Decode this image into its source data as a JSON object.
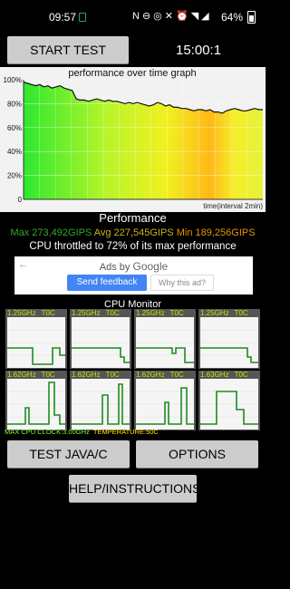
{
  "status_bar": {
    "time": "09:57",
    "battery_text": "64%",
    "icons": [
      "nfc-icon",
      "dnd-icon",
      "hotspot-icon",
      "mute-icon",
      "alarm-off-icon",
      "wifi-icon",
      "signal-icon",
      "battery-icon"
    ]
  },
  "controls": {
    "start_label": "START TEST",
    "timer": "15:00:1"
  },
  "graph": {
    "title": "performance over time graph",
    "xlabel": "time(interval 2min)"
  },
  "chart_data": {
    "type": "line",
    "title": "performance over time graph",
    "xlabel": "time(interval 2min)",
    "ylabel": "",
    "ylim": [
      0,
      100
    ],
    "y_ticks": [
      "0",
      "20%",
      "40%",
      "60%",
      "80%",
      "100%"
    ],
    "grid": true,
    "background": "gradient green to yellow to orange",
    "series": [
      {
        "values": [
          98,
          97,
          96,
          95,
          96,
          94,
          95,
          93,
          94,
          95,
          93,
          92,
          91,
          84,
          83,
          83,
          82,
          83,
          84,
          83,
          82,
          83,
          82,
          82,
          81,
          80,
          81,
          80,
          81,
          80,
          79,
          78,
          79,
          81,
          80,
          78,
          79,
          77,
          77,
          76,
          76,
          75,
          74,
          75,
          75,
          74,
          75,
          73,
          73,
          72,
          74,
          75,
          76,
          75,
          74,
          74,
          75,
          76,
          75,
          75
        ]
      }
    ]
  },
  "performance": {
    "title": "Performance",
    "max": "Max 273,492GIPS",
    "avg": "Avg 227,545GIPS",
    "min": "Min 189,256GIPS",
    "throttle": "CPU throttled to 72% of its max performance"
  },
  "ad": {
    "ads_by_prefix": "Ads by",
    "ads_by_brand": "Google",
    "feedback": "Send feedback",
    "why": "Why this ad?"
  },
  "cpu_monitor": {
    "title": "CPU Monitor",
    "cores": [
      {
        "freq": "1.25GHz",
        "temp": "T0C"
      },
      {
        "freq": "1.25GHz",
        "temp": "T0C"
      },
      {
        "freq": "1.25GHz",
        "temp": "T0C"
      },
      {
        "freq": "1.25GHz",
        "temp": "T0C"
      },
      {
        "freq": "1.62GHz",
        "temp": "T0C"
      },
      {
        "freq": "1.62GHz",
        "temp": "T0C"
      },
      {
        "freq": "1.62GHz",
        "temp": "T0C"
      },
      {
        "freq": "1.63GHz",
        "temp": "T0C"
      }
    ],
    "max_clock": "MAX CPU CLOCK:3.00GHz",
    "temperature": "TEMPERATURE:50C"
  },
  "buttons": {
    "java": "TEST JAVA/C",
    "options": "OPTIONS",
    "help": "HELP/INSTRUCTIONS"
  },
  "colors": {
    "max": "#2faa2f",
    "avg": "#c9b21a",
    "min": "#e19600",
    "cpu_label": "#c8e000",
    "cpu_line": "#1f8a1f"
  }
}
